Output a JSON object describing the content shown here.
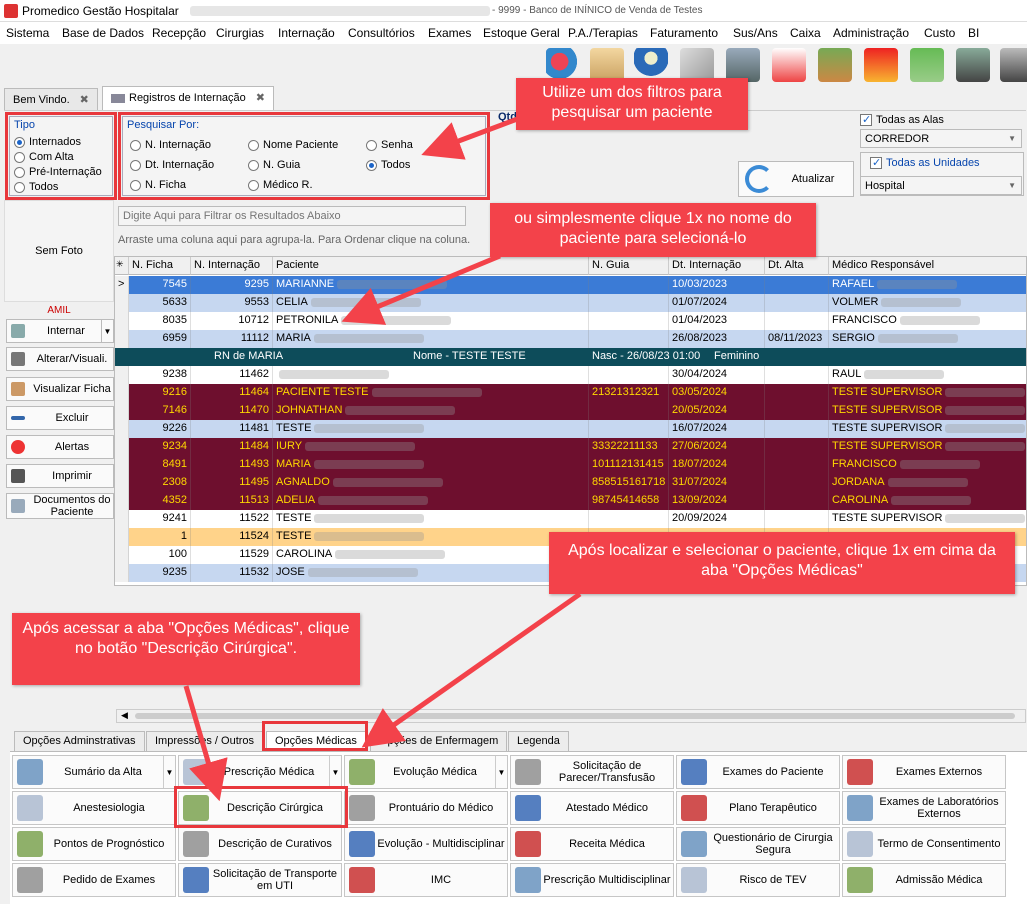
{
  "window": {
    "title": "Promedico Gestão Hospitalar",
    "subtitle": "- 9999 - Banco de INÍNICO de Venda de Testes"
  },
  "menu": [
    "Sistema",
    "Base de Dados",
    "Recepção",
    "Cirurgias",
    "Internação",
    "Consultórios",
    "Exames",
    "Estoque Geral",
    "P.A./Terapias",
    "Faturamento",
    "Sus/Ans",
    "Caixa",
    "Administração",
    "Custo",
    "BI"
  ],
  "doc_tabs": [
    {
      "label": "Bem Vindo."
    },
    {
      "label": "Registros de Internação"
    }
  ],
  "tipo": {
    "title": "Tipo",
    "options": [
      "Internados",
      "Com Alta",
      "Pré-Internação",
      "Todos"
    ]
  },
  "pesquisar": {
    "title": "Pesquisar Por:",
    "options": [
      "N. Internação",
      "Nome Paciente",
      "Senha",
      "Dt. Internação",
      "N. Guia",
      "Todos",
      "N. Ficha",
      "Médico R."
    ]
  },
  "qtd_label": "Qtd",
  "alas": {
    "label": "Todas as Alas",
    "combo": "CORREDOR"
  },
  "unidades": {
    "label": "Todas as Unidades",
    "combo": "Hospital"
  },
  "atualizar_label": "Atualizar",
  "filter_placeholder": "Digite Aqui para Filtrar os Resultados Abaixo",
  "group_hint": "Arraste uma coluna aqui para agrupa-la. Para Ordenar clique na coluna.",
  "sem_foto": "Sem Foto",
  "convenio": "AMIL",
  "side_buttons": [
    "Internar",
    "Alterar/Visuali.",
    "Visualizar Ficha",
    "Excluir",
    "Alertas",
    "Imprimir",
    "Documentos do Paciente"
  ],
  "columns": [
    "N. Ficha",
    "N. Internação",
    "Paciente",
    "N. Guia",
    "Dt. Internação",
    "Dt. Alta",
    "Médico Responsável"
  ],
  "rows": [
    {
      "ficha": "7545",
      "internacao": "9295",
      "paciente": "MARIANNE",
      "guia": "",
      "dt_int": "10/03/2023",
      "dt_alta": "",
      "medico": "RAFAEL",
      "style": "sel"
    },
    {
      "ficha": "5633",
      "internacao": "9553",
      "paciente": "CELIA",
      "guia": "",
      "dt_int": "01/07/2024",
      "dt_alta": "",
      "medico": "VOLMER",
      "style": "blue"
    },
    {
      "ficha": "8035",
      "internacao": "10712",
      "paciente": "PETRONILA",
      "guia": "",
      "dt_int": "01/04/2023",
      "dt_alta": "",
      "medico": "FRANCISCO",
      "style": "white"
    },
    {
      "ficha": "6959",
      "internacao": "11112",
      "paciente": "MARIA",
      "guia": "",
      "dt_int": "26/08/2023",
      "dt_alta": "08/11/2023",
      "medico": "SERGIO",
      "style": "blue"
    },
    {
      "ficha": "9238",
      "internacao": "11462",
      "paciente": "",
      "guia": "",
      "dt_int": "30/04/2024",
      "dt_alta": "",
      "medico": "RAUL",
      "style": "white"
    },
    {
      "ficha": "9216",
      "internacao": "11464",
      "paciente": "PACIENTE TESTE",
      "guia": "21321312321",
      "dt_int": "03/05/2024",
      "dt_alta": "",
      "medico": "TESTE SUPERVISOR",
      "style": "wine"
    },
    {
      "ficha": "7146",
      "internacao": "11470",
      "paciente": "JOHNATHAN",
      "guia": "",
      "dt_int": "20/05/2024",
      "dt_alta": "",
      "medico": "TESTE SUPERVISOR",
      "style": "wine"
    },
    {
      "ficha": "9226",
      "internacao": "11481",
      "paciente": "TESTE",
      "guia": "",
      "dt_int": "16/07/2024",
      "dt_alta": "",
      "medico": "TESTE SUPERVISOR",
      "style": "blue"
    },
    {
      "ficha": "9234",
      "internacao": "11484",
      "paciente": "IURY",
      "guia": "33322211133",
      "dt_int": "27/06/2024",
      "dt_alta": "",
      "medico": "TESTE SUPERVISOR",
      "style": "wine"
    },
    {
      "ficha": "8491",
      "internacao": "11493",
      "paciente": "MARIA",
      "guia": "101112131415",
      "dt_int": "18/07/2024",
      "dt_alta": "",
      "medico": "FRANCISCO",
      "style": "wine"
    },
    {
      "ficha": "2308",
      "internacao": "11495",
      "paciente": "AGNALDO",
      "guia": "858515161718",
      "dt_int": "31/07/2024",
      "dt_alta": "",
      "medico": "JORDANA",
      "style": "wine"
    },
    {
      "ficha": "4352",
      "internacao": "11513",
      "paciente": "ADELIA",
      "guia": "98745414658",
      "dt_int": "13/09/2024",
      "dt_alta": "",
      "medico": "CAROLINA",
      "style": "wine"
    },
    {
      "ficha": "9241",
      "internacao": "11522",
      "paciente": "TESTE",
      "guia": "",
      "dt_int": "20/09/2024",
      "dt_alta": "",
      "medico": "TESTE SUPERVISOR",
      "style": "white"
    },
    {
      "ficha": "1",
      "internacao": "11524",
      "paciente": "TESTE",
      "guia": "",
      "dt_int": "",
      "dt_alta": "",
      "medico": "",
      "style": "orange"
    },
    {
      "ficha": "100",
      "internacao": "11529",
      "paciente": "CAROLINA",
      "guia": "",
      "dt_int": "",
      "dt_alta": "",
      "medico": "",
      "style": "white"
    },
    {
      "ficha": "9235",
      "internacao": "11532",
      "paciente": "JOSE",
      "guia": "",
      "dt_int": "",
      "dt_alta": "",
      "medico": "",
      "style": "blue"
    }
  ],
  "detail_row": {
    "rn": "RN de MARIA",
    "nome": "Nome - TESTE TESTE",
    "nasc": "Nasc - 26/08/23 01:00",
    "sexo": "Feminino"
  },
  "callouts": {
    "c1": "Utilize um dos filtros para pesquisar um paciente",
    "c2": "ou simplesmente clique 1x no nome do paciente para selecioná-lo",
    "c3": "Após localizar e selecionar o paciente, clique 1x em cima da aba \"Opções Médicas\"",
    "c4": "Após acessar a aba \"Opções Médicas\", clique no botão \"Descrição Cirúrgica\"."
  },
  "bottom_tabs": [
    "Opções Adminstrativas",
    "Impressões / Outros",
    "Opções Médicas",
    "Opções de Enfermagem",
    "Legenda"
  ],
  "options_buttons": [
    [
      "Sumário da Alta",
      "Prescrição Médica",
      "Evolução Médica",
      "Solicitação de Parecer/Transfusão",
      "Exames do Paciente",
      "Exames Externos"
    ],
    [
      "Anestesiologia",
      "Descrição Cirúrgica",
      "Prontuário do Médico",
      "Atestado Médico",
      "Plano Terapêutico",
      "Exames de Laboratórios Externos"
    ],
    [
      "Pontos de Prognóstico",
      "Descrição de Curativos",
      "Evolução - Multidisciplinar",
      "Receita Médica",
      "Questionário de Cirurgia Segura",
      "Termo de Consentimento"
    ],
    [
      "Pedido de Exames",
      "Solicitação de Transporte em UTI",
      "IMC",
      "Prescrição Multidisciplinar",
      "Risco de TEV",
      "Admissão Médica"
    ]
  ],
  "colors": {
    "accent_red": "#f3424a",
    "wine": "#6e0f2e",
    "selected": "#3b7bd6",
    "light_blue": "#c6d7f0",
    "orange": "#ffd38a",
    "detail": "#0d4c5a"
  }
}
